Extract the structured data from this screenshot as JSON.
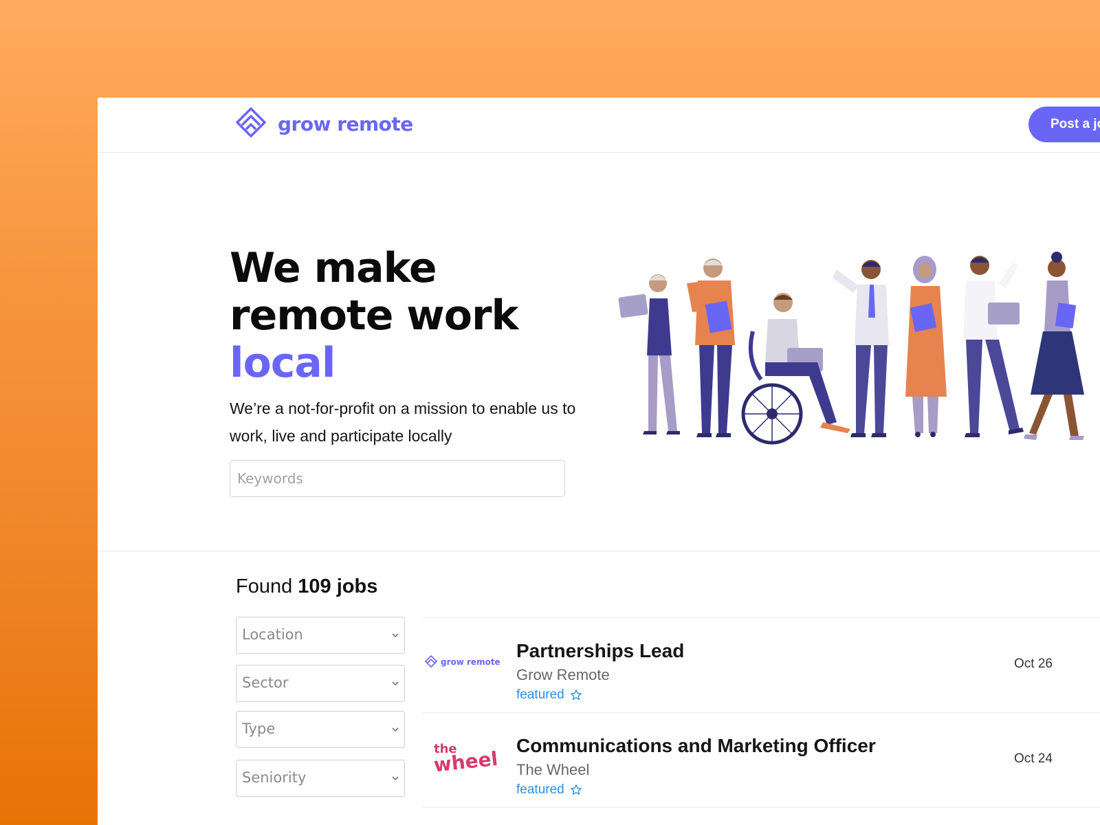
{
  "header": {
    "brand": "grow remote",
    "post_button_label": "Post a job"
  },
  "hero": {
    "title_line1": "We make",
    "title_line2": "remote work",
    "title_accent": "local",
    "subtitle": "We’re a not-for-profit on a mission to enable us to work, live and participate locally",
    "search_placeholder": "Keywords"
  },
  "results": {
    "found_prefix": "Found",
    "count_text": "109 jobs"
  },
  "filters": [
    {
      "label": "Location"
    },
    {
      "label": "Sector"
    },
    {
      "label": "Type"
    },
    {
      "label": "Seniority"
    }
  ],
  "jobs": [
    {
      "title": "Partnerships Lead",
      "company": "Grow Remote",
      "badge": "featured",
      "date": "Oct 26",
      "logo_text": "grow remote"
    },
    {
      "title": "Communications and Marketing Officer",
      "company": "The Wheel",
      "badge": "featured",
      "date": "Oct 24",
      "logo_text_top": "the",
      "logo_text_bottom": "wheel"
    }
  ],
  "colors": {
    "brand": "#6a66f5",
    "link": "#2a8ee8",
    "background_top": "#ffab5e",
    "background_bottom": "#e87305"
  }
}
